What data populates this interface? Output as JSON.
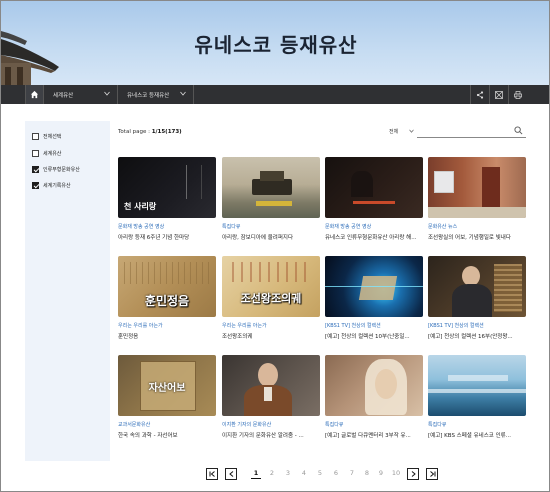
{
  "banner": {
    "title": "유네스코 등재유산"
  },
  "nav": {
    "dropdown1": "세계유산",
    "dropdown2": "유네스코 등재유산"
  },
  "sidebar": {
    "filters": [
      {
        "label": "전체선택",
        "checked": false
      },
      {
        "label": "세계유산",
        "checked": false
      },
      {
        "label": "인류무형문화유산",
        "checked": true
      },
      {
        "label": "세계기록유산",
        "checked": true
      }
    ]
  },
  "main": {
    "total_prefix": "Total page : ",
    "total_value": "1/15(173)",
    "select_value": "전체",
    "search_placeholder": ""
  },
  "cards": [
    {
      "category": "문화재 방송 공연 영상",
      "title": "아리랑 등재 6주년 기념 한마당",
      "overlay": "천 사리랑"
    },
    {
      "category": "특집다큐",
      "title": "아리랑, 잠보디아에 울려퍼지다",
      "overlay": ""
    },
    {
      "category": "문화재 방송 공연 영상",
      "title": "유네스코 인류무형문화유산 아리랑 해...",
      "overlay": ""
    },
    {
      "category": "문화유산 뉴스",
      "title": "조선왕실의 어보, 기념행일로 빛내다",
      "overlay": ""
    },
    {
      "category": "우리는 우리를 아는가",
      "title": "훈민정음",
      "overlay": "훈민정음"
    },
    {
      "category": "우리는 우리를 아는가",
      "title": "조선왕조의궤",
      "overlay": "조선왕조의궤"
    },
    {
      "category": "[KBS1 TV] 천상의 컬렉션",
      "title": "[예고] 천상의 컬렉션 10부(난중일...",
      "overlay": ""
    },
    {
      "category": "[KBS1 TV] 천상의 컬렉션",
      "title": "[예고] 천상의 컬렉션 16부(안정왕...",
      "overlay": ""
    },
    {
      "category": "교과서문화유산",
      "title": "한국 속의 과학 - 자선어보",
      "overlay": "자산어보"
    },
    {
      "category": "이지환 기자의 문화유산",
      "title": "이지환 기자의 문화유산 알려줌 - ...",
      "overlay": ""
    },
    {
      "category": "특집다큐",
      "title": "[예고] 글로벌 다큐멘터리 3부작 유...",
      "overlay": ""
    },
    {
      "category": "특집다큐",
      "title": "[예고] KBS 스페셜 유네스코 인류...",
      "overlay": ""
    }
  ],
  "pagination": {
    "pages": [
      "1",
      "2",
      "3",
      "4",
      "5",
      "6",
      "7",
      "8",
      "9",
      "10"
    ],
    "current": "1"
  },
  "colors": {
    "nav_bg": "#2f3033",
    "accent": "#2a6bb8",
    "sidebar_bg": "#eef3fa"
  }
}
